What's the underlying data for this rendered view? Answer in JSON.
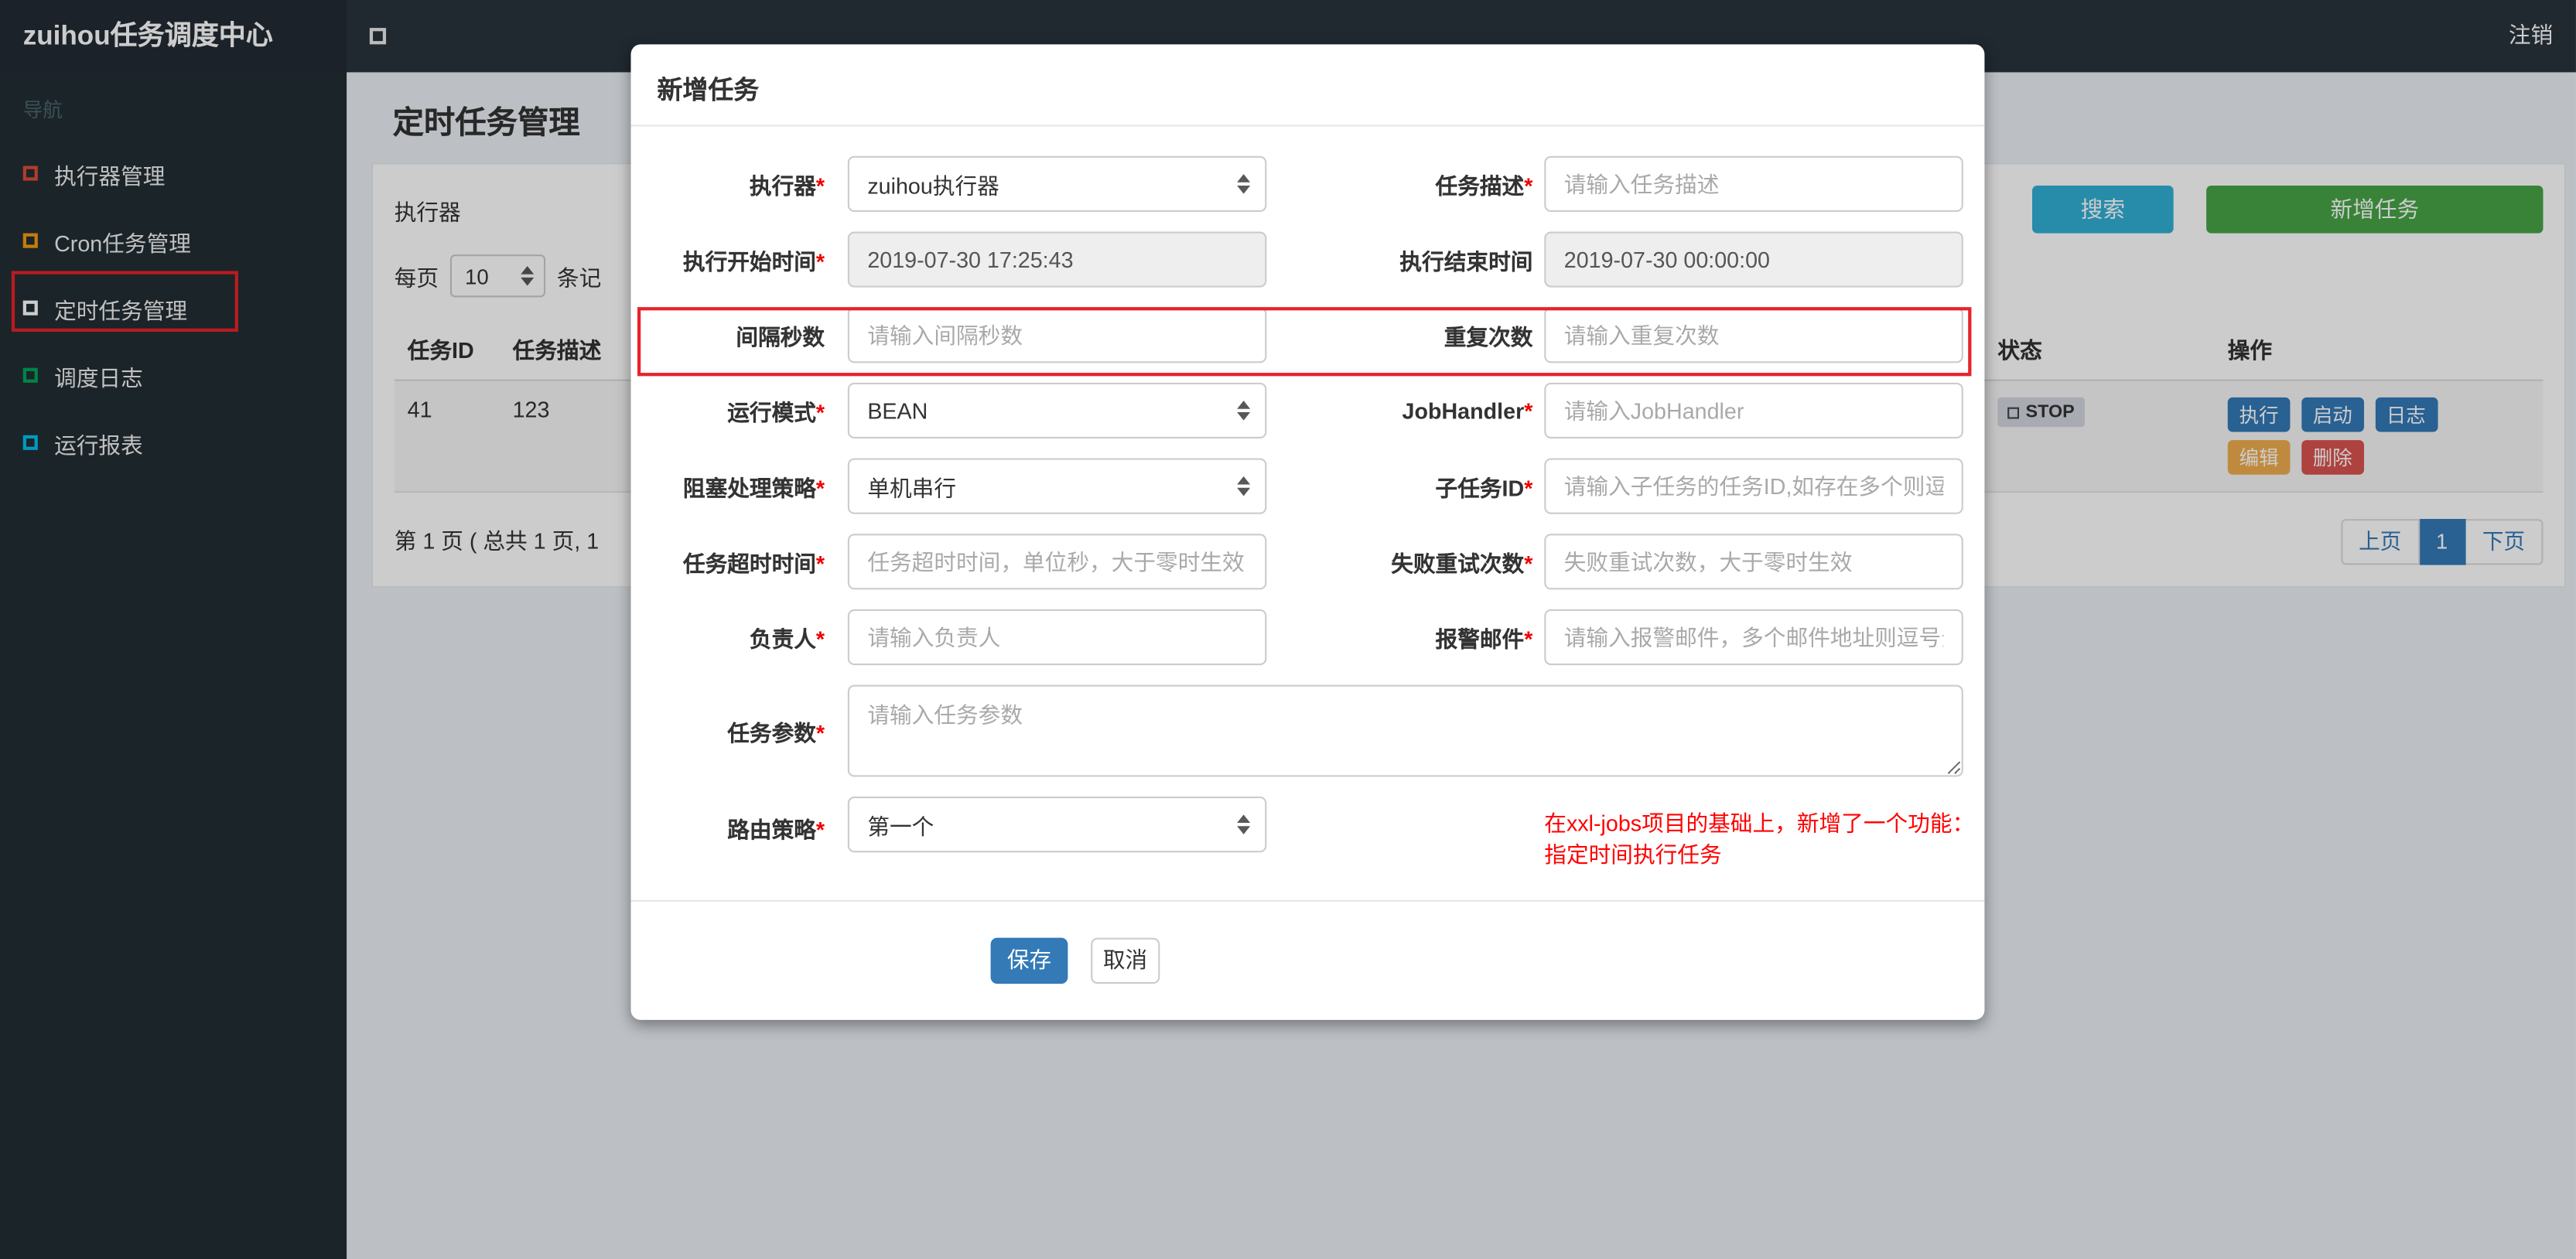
{
  "navbar": {
    "brand": "zuihou任务调度中心",
    "logout_label": "注销"
  },
  "sidebar": {
    "section_label": "导航",
    "items": [
      {
        "label": "执行器管理",
        "icon_color": "#dd4b39"
      },
      {
        "label": "Cron任务管理",
        "icon_color": "#f39c12"
      },
      {
        "label": "定时任务管理",
        "icon_color": "#ffffff",
        "highlighted": true
      },
      {
        "label": "调度日志",
        "icon_color": "#00a65a"
      },
      {
        "label": "运行报表",
        "icon_color": "#00c0ef"
      }
    ]
  },
  "page": {
    "title": "定时任务管理",
    "filter": {
      "executor_label": "执行器",
      "search_button": "搜索",
      "add_button": "新增任务"
    },
    "page_size": {
      "prefix_label": "每页",
      "value": "10",
      "suffix_label": "条记"
    },
    "table": {
      "headers": [
        "任务ID",
        "任务描述",
        "状态",
        "操作"
      ],
      "row": {
        "job_id": "41",
        "job_desc": "123",
        "status": "STOP",
        "action_execute": "执行",
        "action_start": "启动",
        "action_log": "日志",
        "action_edit": "编辑",
        "action_delete": "删除"
      }
    },
    "pagination": {
      "summary": "第 1 页 ( 总共 1 页, 1",
      "prev": "上页",
      "current": "1",
      "next": "下页"
    }
  },
  "modal": {
    "title": "新增任务",
    "fields": {
      "executor": {
        "label": "执行器",
        "required": "*",
        "value": "zuihou执行器"
      },
      "job_desc": {
        "label": "任务描述",
        "required": "*",
        "placeholder": "请输入任务描述"
      },
      "start_time": {
        "label": "执行开始时间",
        "required": "*",
        "value": "2019-07-30 17:25:43"
      },
      "end_time": {
        "label": "执行结束时间",
        "required": "",
        "value": "2019-07-30 00:00:00"
      },
      "interval_seconds": {
        "label": "间隔秒数",
        "required": "",
        "placeholder": "请输入间隔秒数"
      },
      "repeat_count": {
        "label": "重复次数",
        "required": "",
        "placeholder": "请输入重复次数"
      },
      "run_mode": {
        "label": "运行模式",
        "required": "*",
        "value": "BEAN"
      },
      "job_handler": {
        "label": "JobHandler",
        "required": "*",
        "placeholder": "请输入JobHandler"
      },
      "block_strategy": {
        "label": "阻塞处理策略",
        "required": "*",
        "value": "单机串行"
      },
      "child_job_id": {
        "label": "子任务ID",
        "required": "*",
        "placeholder": "请输入子任务的任务ID,如存在多个则逗..."
      },
      "timeout": {
        "label": "任务超时时间",
        "required": "*",
        "placeholder": "任务超时时间，单位秒，大于零时生效"
      },
      "fail_retry": {
        "label": "失败重试次数",
        "required": "*",
        "placeholder": "失败重试次数，大于零时生效"
      },
      "owner": {
        "label": "负责人",
        "required": "*",
        "placeholder": "请输入负责人"
      },
      "alarm_email": {
        "label": "报警邮件",
        "required": "*",
        "placeholder": "请输入报警邮件，多个邮件地址则逗号分..."
      },
      "job_param": {
        "label": "任务参数",
        "required": "*",
        "placeholder": "请输入任务参数"
      },
      "route_strategy": {
        "label": "路由策略",
        "required": "*",
        "value": "第一个"
      }
    },
    "note_line1": "在xxl-jobs项目的基础上，新增了一个功能：",
    "note_line2": "指定时间执行任务",
    "save_button": "保存",
    "cancel_button": "取消"
  },
  "colors": {
    "annotation_red": "#e8222a",
    "primary_blue": "#337ab7",
    "success_green": "#47a447",
    "info_teal": "#31b0d5",
    "warning_orange": "#f0ad4e",
    "danger_red": "#d9534f",
    "status_stop_bg": "#d2d6de"
  }
}
